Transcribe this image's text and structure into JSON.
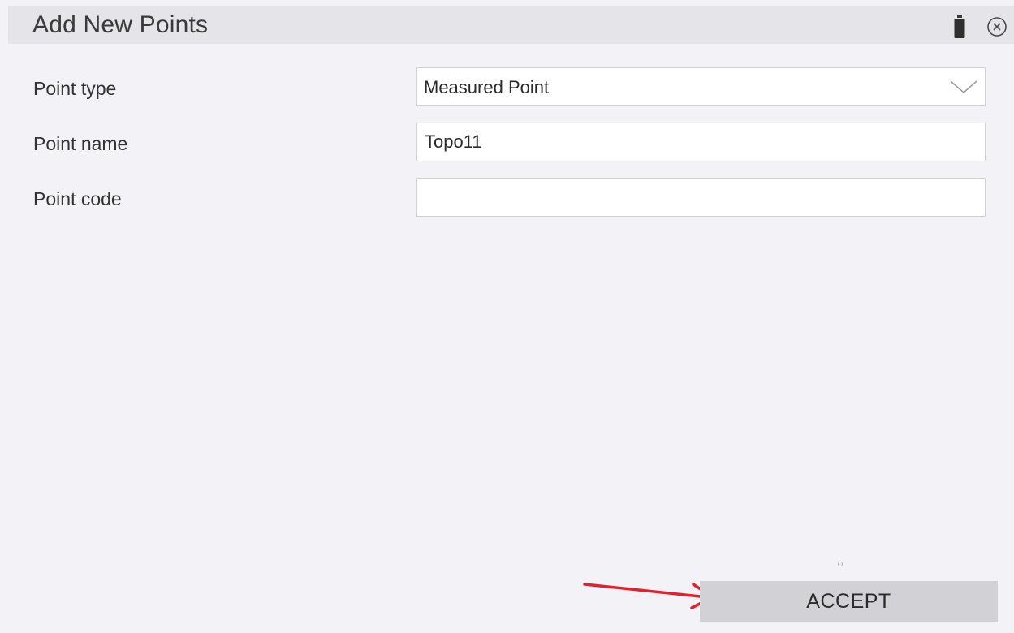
{
  "dialog": {
    "title": "Add New Points",
    "battery_icon": "battery-icon",
    "close_icon": "close-circle-icon"
  },
  "form": {
    "point_type": {
      "label": "Point type",
      "value": "Measured Point",
      "icon": "chevron-down-icon"
    },
    "point_name": {
      "label": "Point name",
      "value": "Topo11"
    },
    "point_code": {
      "label": "Point code",
      "value": ""
    }
  },
  "actions": {
    "accept_label": "ACCEPT"
  },
  "annotation": {
    "arrow_color": "#e0212e"
  }
}
